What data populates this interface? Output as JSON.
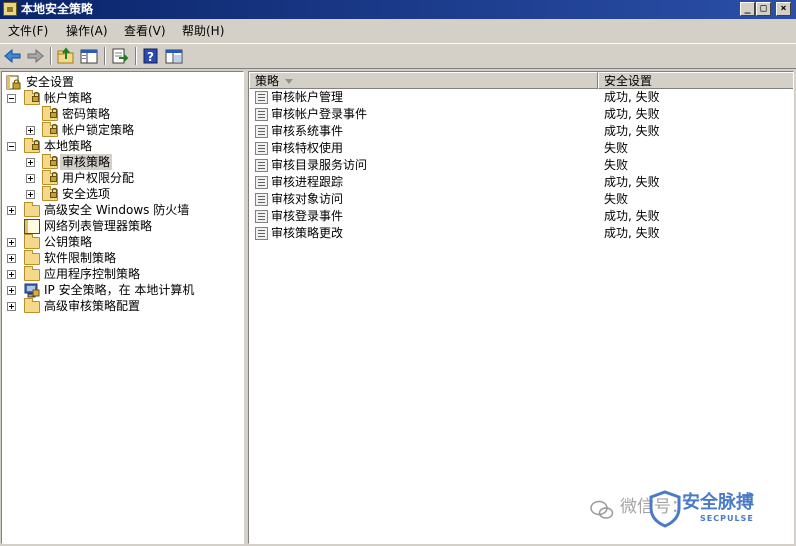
{
  "window": {
    "title": "本地安全策略",
    "min_label": "_",
    "max_label": "□",
    "close_label": "×"
  },
  "menu": [
    {
      "label": "文件(F)"
    },
    {
      "label": "操作(A)"
    },
    {
      "label": "查看(V)"
    },
    {
      "label": "帮助(H)"
    }
  ],
  "toolbar": {
    "buttons": [
      "back-icon",
      "forward-icon",
      "up-folder-icon",
      "show-hide-tree-icon",
      "export-list-icon",
      "help-icon",
      "properties-icon"
    ]
  },
  "tree": [
    {
      "label": "安全设置",
      "level": 0,
      "expander": "none",
      "icon": "root-security-icon"
    },
    {
      "label": "帐户策略",
      "level": 1,
      "expander": "minus",
      "icon": "folder-lock-icon"
    },
    {
      "label": "密码策略",
      "level": 2,
      "expander": "none",
      "icon": "folder-lock-icon"
    },
    {
      "label": "帐户锁定策略",
      "level": 2,
      "expander": "plus",
      "icon": "folder-lock-icon"
    },
    {
      "label": "本地策略",
      "level": 1,
      "expander": "minus",
      "icon": "folder-lock-icon"
    },
    {
      "label": "审核策略",
      "level": 2,
      "expander": "plus",
      "icon": "folder-lock-icon",
      "selected": true
    },
    {
      "label": "用户权限分配",
      "level": 2,
      "expander": "plus",
      "icon": "folder-lock-icon"
    },
    {
      "label": "安全选项",
      "level": 2,
      "expander": "plus",
      "icon": "folder-lock-icon"
    },
    {
      "label": "高级安全 Windows 防火墙",
      "level": 1,
      "expander": "plus",
      "icon": "folder-icon"
    },
    {
      "label": "网络列表管理器策略",
      "level": 1,
      "expander": "none",
      "icon": "document-icon"
    },
    {
      "label": "公钥策略",
      "level": 1,
      "expander": "plus",
      "icon": "folder-icon"
    },
    {
      "label": "软件限制策略",
      "level": 1,
      "expander": "plus",
      "icon": "folder-icon"
    },
    {
      "label": "应用程序控制策略",
      "level": 1,
      "expander": "plus",
      "icon": "folder-icon"
    },
    {
      "label": "IP 安全策略，在 本地计算机",
      "level": 1,
      "expander": "plus",
      "icon": "ip-security-icon"
    },
    {
      "label": "高级审核策略配置",
      "level": 1,
      "expander": "plus",
      "icon": "folder-icon"
    }
  ],
  "list": {
    "columns": [
      {
        "label": "策略"
      },
      {
        "label": "安全设置"
      }
    ],
    "rows": [
      {
        "name": "审核帐户管理",
        "setting": "成功, 失败"
      },
      {
        "name": "审核帐户登录事件",
        "setting": "成功, 失败"
      },
      {
        "name": "审核系统事件",
        "setting": "成功, 失败"
      },
      {
        "name": "审核特权使用",
        "setting": "失败"
      },
      {
        "name": "审核目录服务访问",
        "setting": "失败"
      },
      {
        "name": "审核进程跟踪",
        "setting": "成功, 失败"
      },
      {
        "name": "审核对象访问",
        "setting": "失败"
      },
      {
        "name": "审核登录事件",
        "setting": "成功, 失败"
      },
      {
        "name": "审核策略更改",
        "setting": "成功, 失败"
      }
    ]
  },
  "watermark": {
    "text": "微信号：",
    "brand": "安全脉搏",
    "sub": "SECPULSE"
  },
  "colors": {
    "title_bar": "#0a246a",
    "chrome": "#d4d0c8",
    "selection": "#d4d0c8"
  }
}
